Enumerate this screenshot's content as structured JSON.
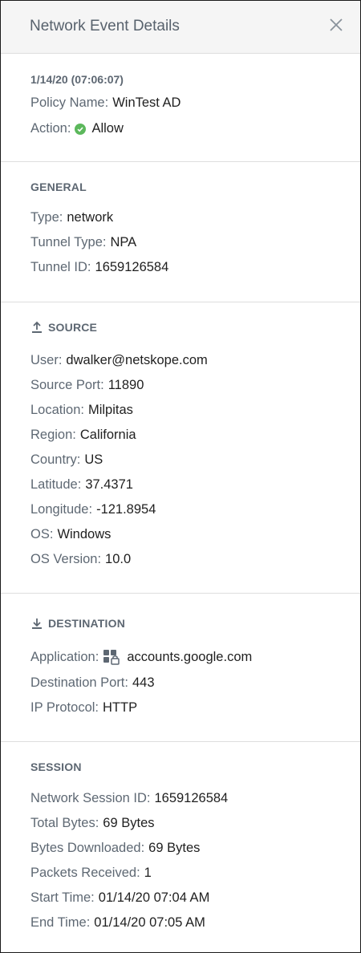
{
  "header": {
    "title": "Network Event Details"
  },
  "summary": {
    "timestamp": "1/14/20 (07:06:07)",
    "policy_label": "Policy Name:",
    "policy_value": "WinTest AD",
    "action_label": "Action:",
    "action_value": "Allow"
  },
  "general": {
    "heading": "GENERAL",
    "rows": [
      {
        "label": "Type:",
        "value": "network"
      },
      {
        "label": "Tunnel Type:",
        "value": "NPA"
      },
      {
        "label": "Tunnel ID:",
        "value": "1659126584"
      }
    ]
  },
  "source": {
    "heading": "SOURCE",
    "rows": [
      {
        "label": "User:",
        "value": "dwalker@netskope.com"
      },
      {
        "label": "Source Port:",
        "value": "11890"
      },
      {
        "label": "Location:",
        "value": "Milpitas"
      },
      {
        "label": "Region:",
        "value": "California"
      },
      {
        "label": "Country:",
        "value": "US"
      },
      {
        "label": "Latitude:",
        "value": "37.4371"
      },
      {
        "label": "Longitude:",
        "value": "-121.8954"
      },
      {
        "label": "OS:",
        "value": "Windows"
      },
      {
        "label": "OS Version:",
        "value": "10.0"
      }
    ]
  },
  "destination": {
    "heading": "DESTINATION",
    "rows": [
      {
        "label": "Application:",
        "value": "accounts.google.com"
      },
      {
        "label": "Destination Port:",
        "value": "443"
      },
      {
        "label": "IP Protocol:",
        "value": "HTTP"
      }
    ]
  },
  "session": {
    "heading": "SESSION",
    "rows": [
      {
        "label": "Network Session ID:",
        "value": "1659126584"
      },
      {
        "label": "Total Bytes:",
        "value": "69 Bytes"
      },
      {
        "label": "Bytes Downloaded:",
        "value": "69 Bytes"
      },
      {
        "label": "Packets Received:",
        "value": "1"
      },
      {
        "label": "Start Time:",
        "value": "01/14/20 07:04 AM"
      },
      {
        "label": "End Time:",
        "value": "01/14/20 07:05 AM"
      }
    ]
  },
  "colors": {
    "allow_green": "#5cb85c",
    "label_gray": "#5e6873",
    "header_bg": "#f5f5f5"
  }
}
